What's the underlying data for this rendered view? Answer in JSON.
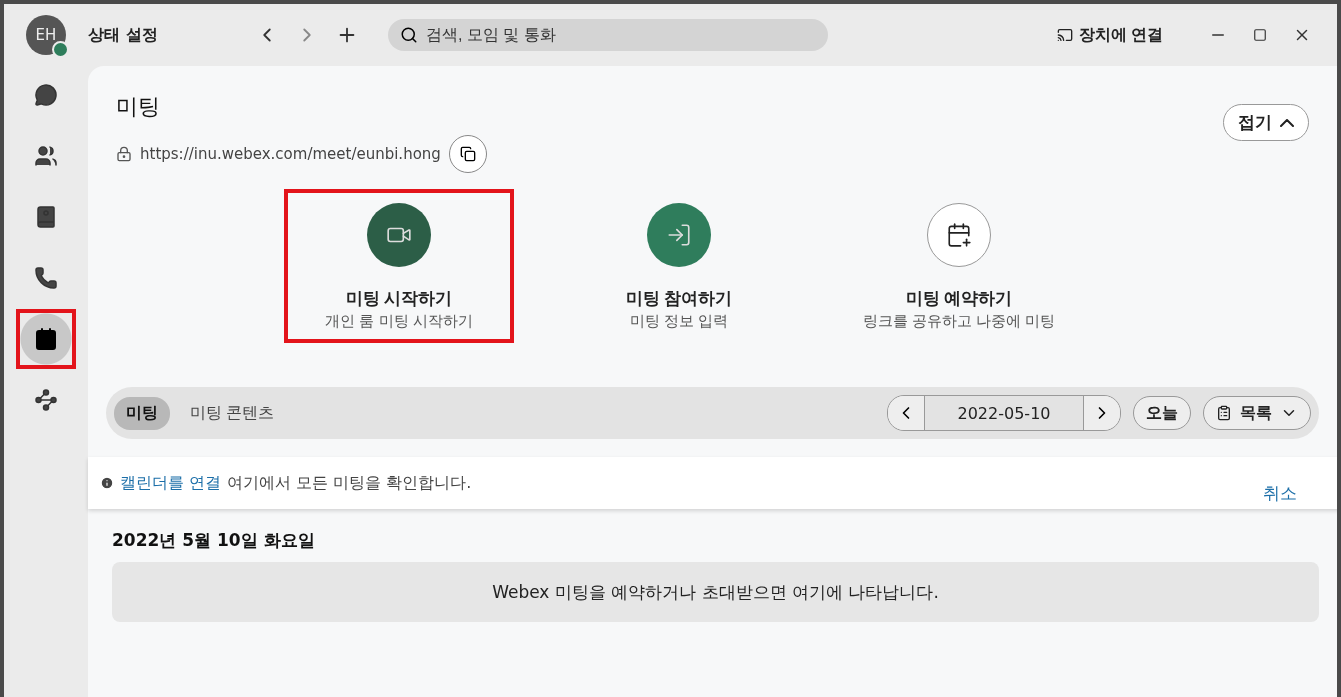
{
  "titlebar": {
    "avatar": "EH",
    "status": "상태 설정",
    "search": {
      "placeholder": "검색, 모임 및 통화"
    },
    "connect": "장치에 연결"
  },
  "sidebar": {
    "items": [
      {
        "kind": "chat",
        "selected": false,
        "highlighted": false
      },
      {
        "kind": "teams",
        "selected": false,
        "highlighted": false
      },
      {
        "kind": "contacts",
        "selected": false,
        "highlighted": false
      },
      {
        "kind": "calls",
        "selected": false,
        "highlighted": false
      },
      {
        "kind": "meetings",
        "selected": true,
        "highlighted": true
      },
      {
        "kind": "apps",
        "selected": false,
        "highlighted": false
      }
    ]
  },
  "header": {
    "title": "미팅",
    "url": "https://inu.webex.com/meet/eunbi.hong",
    "collapse": "접기"
  },
  "actions": [
    {
      "kind": "start",
      "title": "미팅 시작하기",
      "subtitle": "개인 룸 미팅 시작하기",
      "highlighted": true
    },
    {
      "kind": "join",
      "title": "미팅 참여하기",
      "subtitle": "미팅 정보 입력",
      "highlighted": false
    },
    {
      "kind": "schedule",
      "title": "미팅 예약하기",
      "subtitle": "링크를 공유하고 나중에 미팅",
      "highlighted": false
    }
  ],
  "tabs": [
    {
      "label": "미팅",
      "selected": true
    },
    {
      "label": "미팅 콘텐츠",
      "selected": false
    }
  ],
  "date_nav": {
    "date": "2022-05-10",
    "today": "오늘",
    "view": "목록"
  },
  "banner": {
    "link": "캘린더를 연결",
    "text": "여기에서 모든 미팅을 확인합니다.",
    "cancel": "취소"
  },
  "day": {
    "heading": "2022년 5월 10일 화요일",
    "empty": "Webex 미팅을 예약하거나 초대받으면 여기에 나타납니다."
  }
}
